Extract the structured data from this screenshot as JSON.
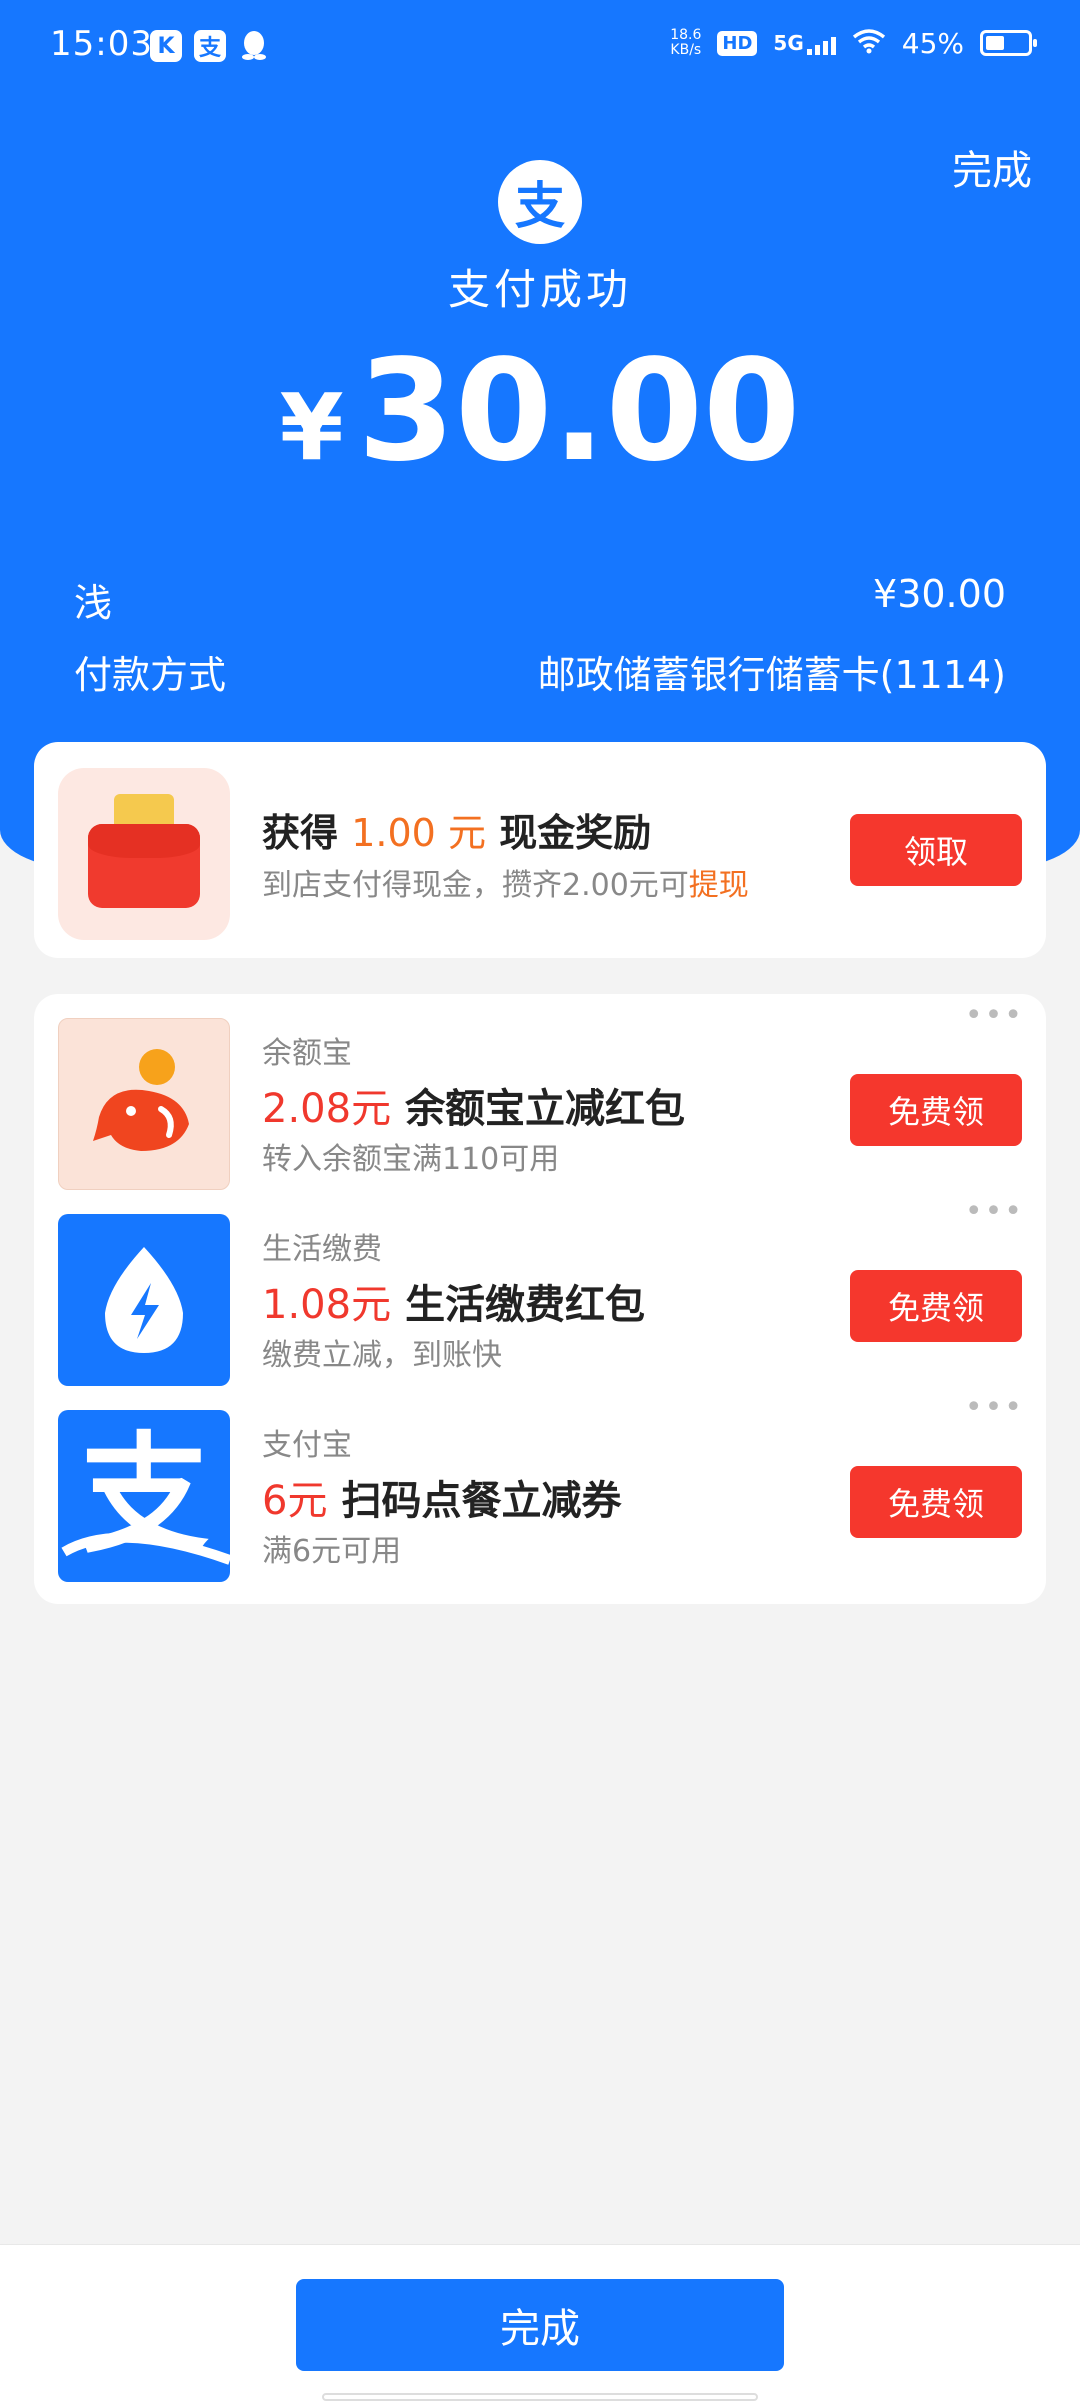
{
  "status_bar": {
    "time": "15:03",
    "app_icon_1": "K",
    "app_icon_2": "支",
    "net_speed_value": "18.6",
    "net_speed_unit": "KB/s",
    "hd": "HD",
    "network": "5G",
    "battery": "45%",
    "battery_level": 0.45
  },
  "header": {
    "done_label": "完成",
    "logo_char": "支",
    "status_text": "支付成功",
    "currency": "¥",
    "amount": "30.00",
    "merchant_label": "浅",
    "merchant_amount": "¥30.00",
    "payment_method_label": "付款方式",
    "payment_method_value": "邮政储蓄银行储蓄卡(1114)"
  },
  "reward": {
    "title_prefix": "获得",
    "title_amount": "1.00 元",
    "title_suffix": "现金奖励",
    "subtitle": "到店支付得现金，攒齐2.00元可",
    "subtitle_link": "提现",
    "button_label": "领取",
    "icon": "red-envelope-icon"
  },
  "offers": [
    {
      "category": "余额宝",
      "amount": "2.08元",
      "title": "余额宝立减红包",
      "subtitle": "转入余额宝满110可用",
      "button_label": "免费领",
      "icon": "yuebao-fish-icon"
    },
    {
      "category": "生活缴费",
      "amount": "1.08元",
      "title": "生活缴费红包",
      "subtitle": "缴费立减，到账快",
      "button_label": "免费领",
      "icon": "lightning-drop-icon"
    },
    {
      "category": "支付宝",
      "amount": "6元",
      "title": "扫码点餐立减券",
      "subtitle": "满6元可用",
      "button_label": "免费领",
      "icon": "alipay-logo-icon"
    }
  ],
  "more_dots": "•••",
  "bottom": {
    "done_label": "完成"
  },
  "colors": {
    "primary": "#1677ff",
    "button_red": "#f5372d",
    "accent_orange": "#f37021",
    "amount_red": "#f0382d"
  }
}
